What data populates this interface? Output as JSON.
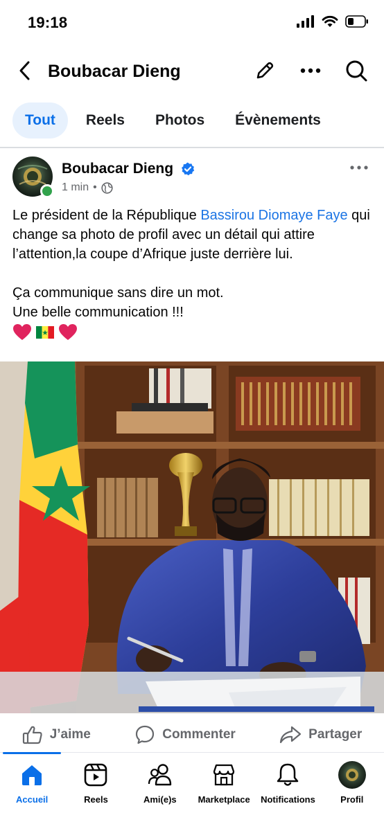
{
  "status": {
    "time": "19:18"
  },
  "header": {
    "title": "Boubacar Dieng"
  },
  "tabs": [
    {
      "label": "Tout",
      "active": true
    },
    {
      "label": "Reels",
      "active": false
    },
    {
      "label": "Photos",
      "active": false
    },
    {
      "label": "Évènements",
      "active": false
    }
  ],
  "post": {
    "author": "Boubacar Dieng",
    "time": "1 min",
    "separator": "•",
    "text_before_mention": "Le président de la République ",
    "mention": "Bassirou Diomaye Faye",
    "text_after_mention": " qui change sa photo de profil avec un détail qui attire l’attention,la coupe d’Afrique juste derrière lui.",
    "line2": "Ça communique sans dire un mot.",
    "line3": "Une belle communication !!!"
  },
  "actions": {
    "like": "J’aime",
    "comment": "Commenter",
    "share": "Partager"
  },
  "bottom_nav": [
    {
      "label": "Accueil",
      "icon": "home-icon",
      "active": true
    },
    {
      "label": "Reels",
      "icon": "reels-icon",
      "active": false
    },
    {
      "label": "Ami(e)s",
      "icon": "friends-icon",
      "active": false
    },
    {
      "label": "Marketplace",
      "icon": "marketplace-icon",
      "active": false
    },
    {
      "label": "Notifications",
      "icon": "bell-icon",
      "active": false
    },
    {
      "label": "Profil",
      "icon": "profile-avatar",
      "active": false
    }
  ],
  "colors": {
    "accent": "#0a6fe8",
    "mention": "#1b74e4",
    "secondary_text": "#65676b",
    "verified": "#1877f2",
    "online": "#31a24c"
  }
}
